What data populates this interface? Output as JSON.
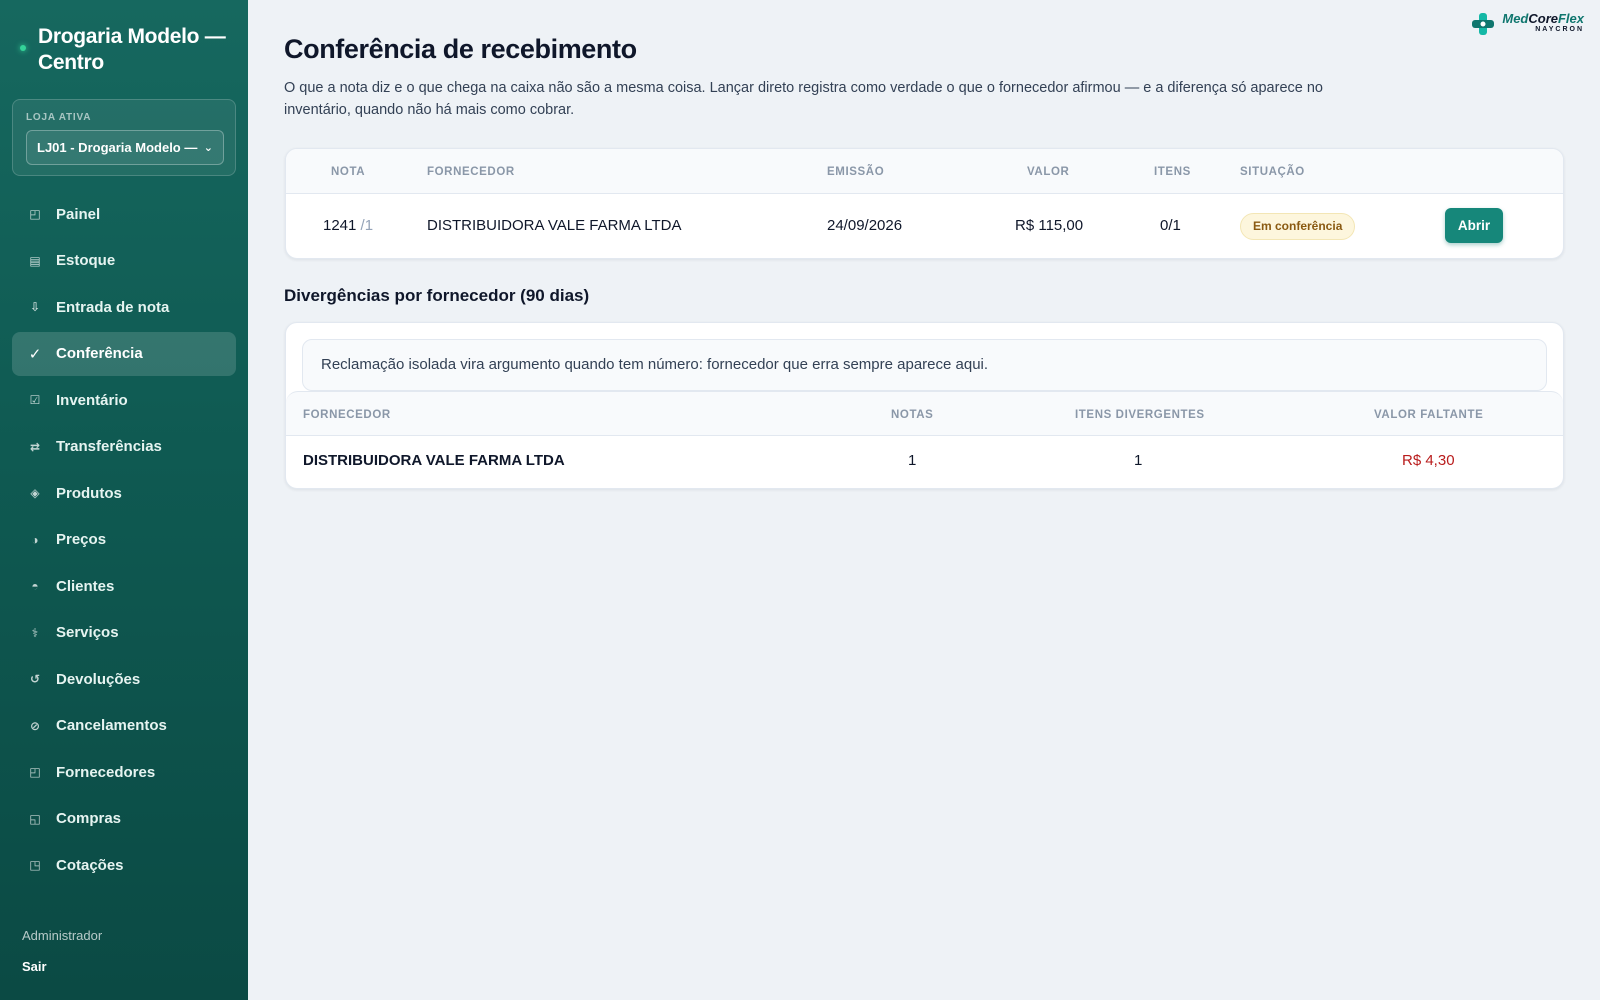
{
  "sidebar": {
    "brand": "Drogaria Modelo — Centro",
    "store_label": "LOJA ATIVA",
    "store_value": "LJ01 - Drogaria Modelo —",
    "items": [
      {
        "label": "Painel",
        "icon": "panel-icon",
        "glyph": "◰"
      },
      {
        "label": "Estoque",
        "icon": "stock-icon",
        "glyph": "▤"
      },
      {
        "label": "Entrada de nota",
        "icon": "arrow-down-icon",
        "glyph": "⇩"
      },
      {
        "label": "Conferência",
        "icon": "check-icon",
        "glyph": "✓"
      },
      {
        "label": "Inventário",
        "icon": "checkbox-icon",
        "glyph": "☑"
      },
      {
        "label": "Transferências",
        "icon": "transfer-icon",
        "glyph": "⇄"
      },
      {
        "label": "Produtos",
        "icon": "diamond-icon",
        "glyph": "◈"
      },
      {
        "label": "Preços",
        "icon": "half-circle-icon",
        "glyph": "◑"
      },
      {
        "label": "Clientes",
        "icon": "client-icon",
        "glyph": "◓"
      },
      {
        "label": "Serviços",
        "icon": "service-icon",
        "glyph": "⚕"
      },
      {
        "label": "Devoluções",
        "icon": "return-icon",
        "glyph": "↺"
      },
      {
        "label": "Cancelamentos",
        "icon": "cancel-icon",
        "glyph": "⊘"
      },
      {
        "label": "Fornecedores",
        "icon": "supplier-icon",
        "glyph": "◰"
      },
      {
        "label": "Compras",
        "icon": "purchase-icon",
        "glyph": "◱"
      },
      {
        "label": "Cotações",
        "icon": "quote-icon",
        "glyph": "◳"
      }
    ],
    "active_index": 3,
    "user_role": "Administrador",
    "logout": "Sair"
  },
  "logo": {
    "main_a": "Med",
    "main_b": "Core",
    "main_c": "Flex",
    "sub": "NAYCRON",
    "accent": "#0f766e"
  },
  "page": {
    "title": "Conferência de recebimento",
    "intro": "O que a nota diz e o que chega na caixa não são a mesma coisa. Lançar direto registra como verdade o que o fornecedor afirmou — e a diferença só aparece no inventário, quando não há mais como cobrar."
  },
  "notes_table": {
    "headers": {
      "nota": "NOTA",
      "fornecedor": "FORNECEDOR",
      "emissao": "EMISSÃO",
      "valor": "VALOR",
      "itens": "ITENS",
      "situacao": "SITUAÇÃO"
    },
    "rows": [
      {
        "nota": "1241",
        "serie": "/1",
        "fornecedor": "DISTRIBUIDORA VALE FARMA LTDA",
        "emissao": "24/09/2026",
        "valor": "R$ 115,00",
        "itens": "0/1",
        "situacao": "Em conferência",
        "action": "Abrir"
      }
    ]
  },
  "divergences": {
    "title": "Divergências por fornecedor (90 dias)",
    "callout": "Reclamação isolada vira argumento quando tem número: fornecedor que erra sempre aparece aqui.",
    "headers": {
      "fornecedor": "FORNECEDOR",
      "notas": "NOTAS",
      "itens": "ITENS DIVERGENTES",
      "valor": "VALOR FALTANTE"
    },
    "rows": [
      {
        "fornecedor": "DISTRIBUIDORA VALE FARMA LTDA",
        "notas": "1",
        "itens": "1",
        "valor": "R$ 4,30"
      }
    ]
  },
  "colors": {
    "sidebar": "#0f5a52",
    "primary_button": "#16877a",
    "negative": "#b91c1c",
    "badge_bg": "#fdf6dd"
  }
}
